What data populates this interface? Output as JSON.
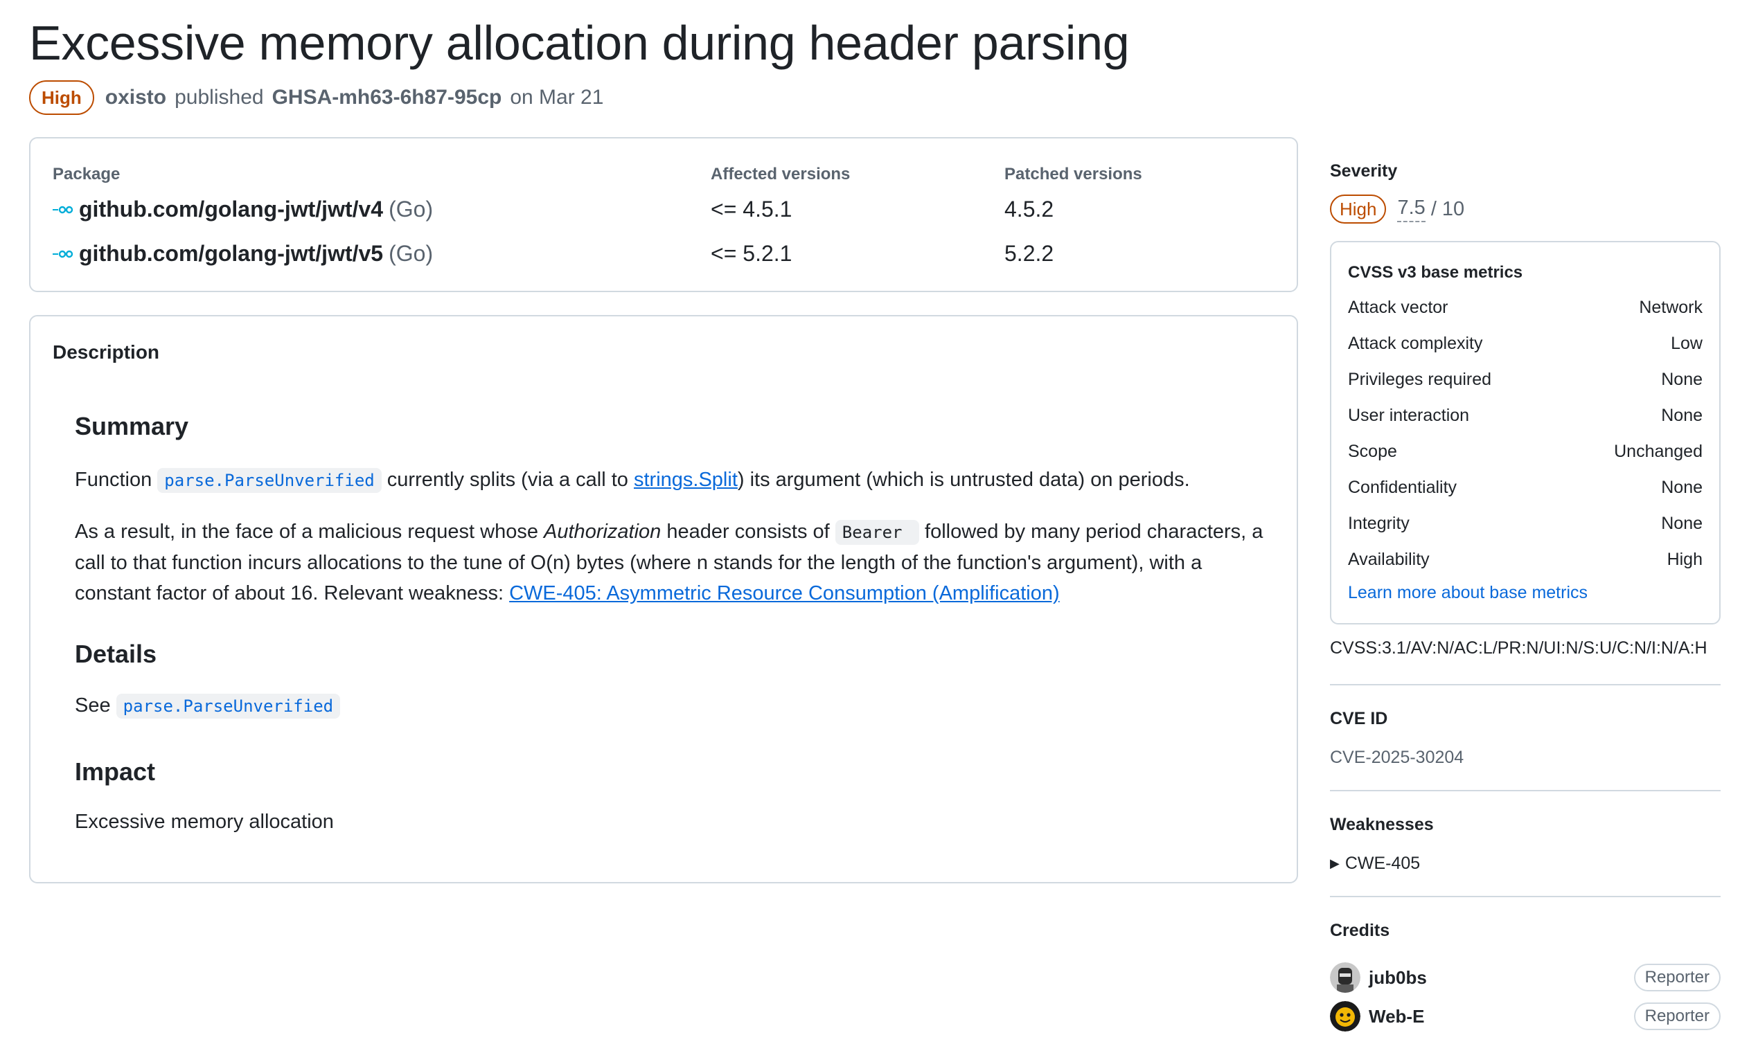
{
  "advisory": {
    "title": "Excessive memory allocation during header parsing",
    "severity_label": "High",
    "author": "oxisto",
    "published_word": "published",
    "ghsa_id": "GHSA-mh63-6h87-95cp",
    "date_text": "on Mar 21"
  },
  "packages": {
    "header_package": "Package",
    "header_affected": "Affected versions",
    "header_patched": "Patched versions",
    "rows": [
      {
        "name": "github.com/golang-jwt/jwt/v4",
        "ecosystem": "(Go)",
        "affected": "<= 4.5.1",
        "patched": "4.5.2"
      },
      {
        "name": "github.com/golang-jwt/jwt/v5",
        "ecosystem": "(Go)",
        "affected": "<= 5.2.1",
        "patched": "5.2.2"
      }
    ]
  },
  "description": {
    "heading": "Description",
    "summary_heading": "Summary",
    "p1_before": "Function",
    "p1_code": "parse.ParseUnverified",
    "p1_mid": "currently splits (via a call to",
    "p1_link": "strings.Split",
    "p1_after": ") its argument (which is untrusted data) on periods.",
    "p2_a": "As a result, in the face of a malicious request whose",
    "p2_em": "Authorization",
    "p2_b": "header consists of",
    "p2_code": "Bearer ",
    "p2_c": "followed by many period characters, a call to that function incurs allocations to the tune of O(n) bytes (where n stands for the length of the function's argument), with a constant factor of about 16. Relevant weakness:",
    "p2_link": "CWE-405: Asymmetric Resource Consumption (Amplification)",
    "details_heading": "Details",
    "details_see": "See",
    "details_code": "parse.ParseUnverified",
    "impact_heading": "Impact",
    "impact_text": "Excessive memory allocation"
  },
  "sidebar": {
    "severity_heading": "Severity",
    "severity_badge": "High",
    "score": "7.5",
    "score_suffix": "/ 10",
    "cvss_title": "CVSS v3 base metrics",
    "metrics": [
      {
        "label": "Attack vector",
        "value": "Network"
      },
      {
        "label": "Attack complexity",
        "value": "Low"
      },
      {
        "label": "Privileges required",
        "value": "None"
      },
      {
        "label": "User interaction",
        "value": "None"
      },
      {
        "label": "Scope",
        "value": "Unchanged"
      },
      {
        "label": "Confidentiality",
        "value": "None"
      },
      {
        "label": "Integrity",
        "value": "None"
      },
      {
        "label": "Availability",
        "value": "High"
      }
    ],
    "learn_more": "Learn more about base metrics",
    "vector": "CVSS:3.1/AV:N/AC:L/PR:N/UI:N/S:U/C:N/I:N/A:H",
    "cve_heading": "CVE ID",
    "cve_id": "CVE-2025-30204",
    "weak_heading": "Weaknesses",
    "weakness": "CWE-405",
    "credits_heading": "Credits",
    "credits": [
      {
        "name": "jub0bs",
        "role": "Reporter"
      },
      {
        "name": "Web-E",
        "role": "Reporter"
      }
    ]
  },
  "colors": {
    "severity_high": "#bc4c00",
    "link": "#0969da",
    "muted": "#59636e",
    "border": "#d1d9e0"
  }
}
